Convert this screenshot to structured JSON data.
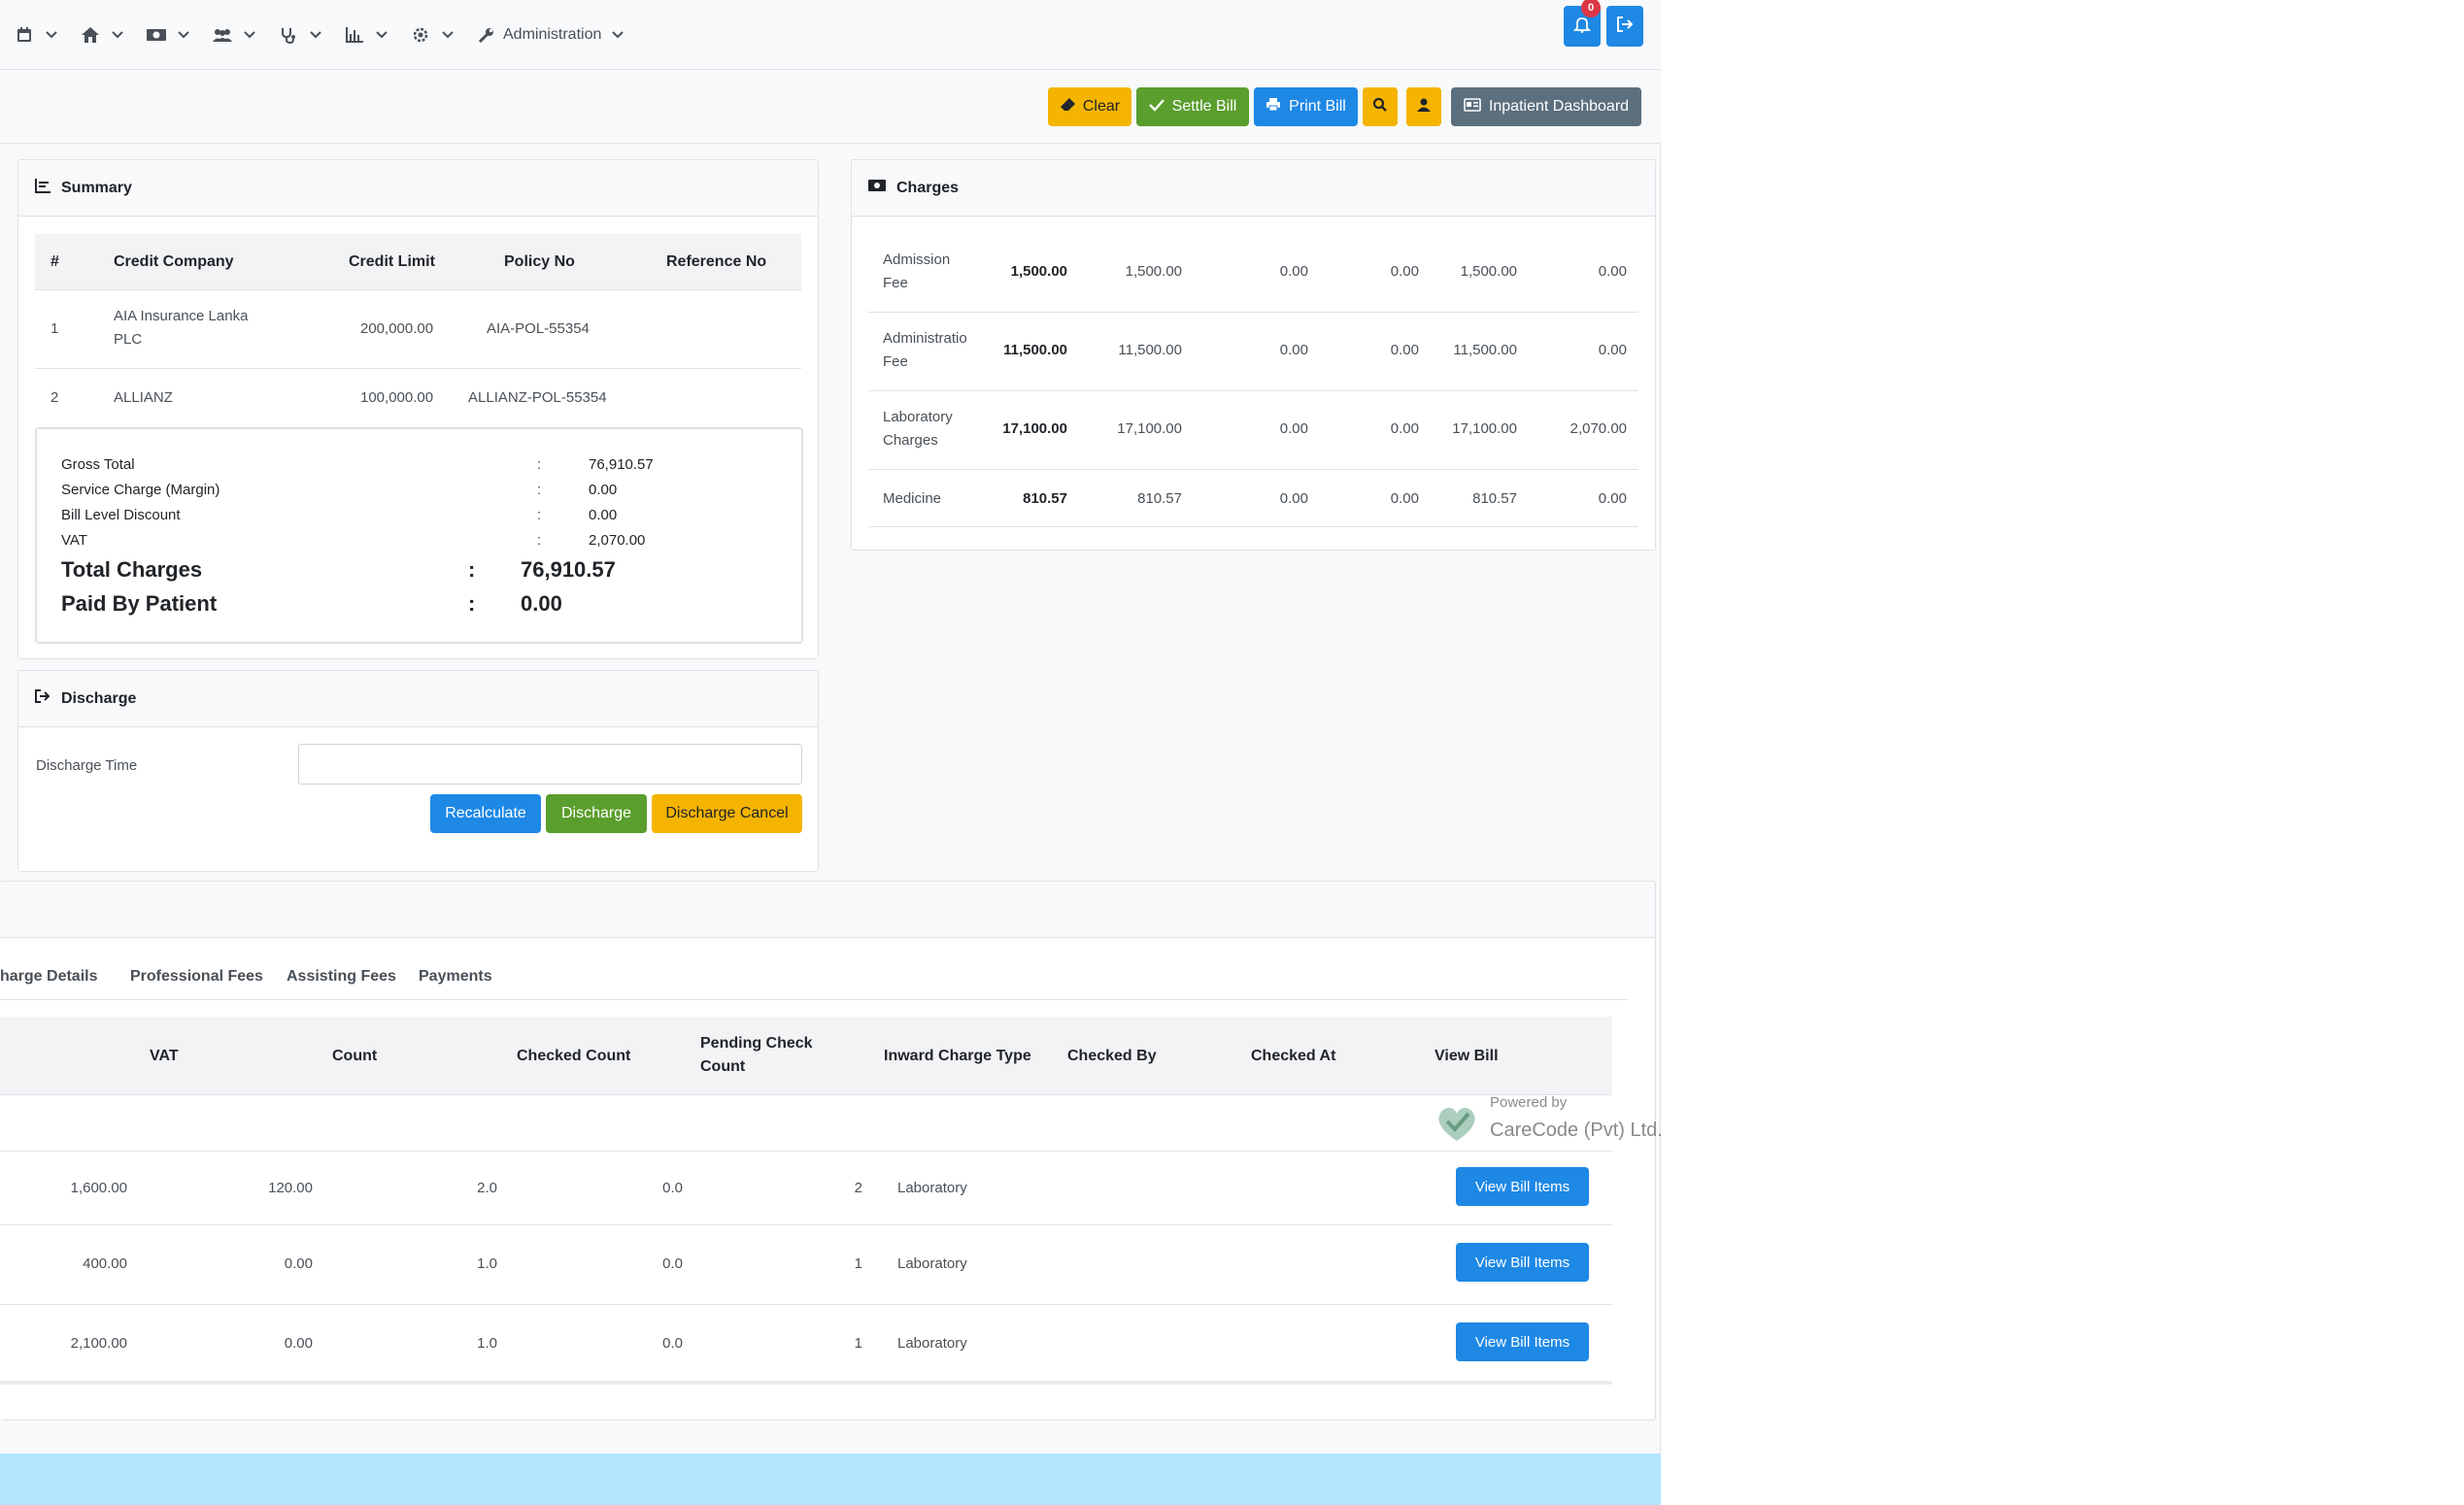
{
  "navbar": {
    "items": [
      {
        "icon": "calendar-icon"
      },
      {
        "icon": "home-icon"
      },
      {
        "icon": "money-icon"
      },
      {
        "icon": "users-icon"
      },
      {
        "icon": "stethoscope-icon"
      },
      {
        "icon": "chart-icon"
      },
      {
        "icon": "gear-icon"
      },
      {
        "icon": "wrench-icon",
        "label": "Administration"
      }
    ],
    "notification_count": "0"
  },
  "toolbar": {
    "clear": "Clear",
    "settle_bill": "Settle Bill",
    "print_bill": "Print Bill",
    "inpatient_dashboard": "Inpatient Dashboard"
  },
  "summary": {
    "title": "Summary",
    "columns": [
      "#",
      "Credit Company",
      "Credit Limit",
      "Policy No",
      "Reference No"
    ],
    "rows": [
      {
        "no": "1",
        "company_line1": "AIA Insurance Lanka",
        "company_line2": "PLC",
        "limit": "200,000.00",
        "policy": "AIA-POL-55354",
        "ref": ""
      },
      {
        "no": "2",
        "company_line1": "ALLIANZ",
        "company_line2": "",
        "limit": "100,000.00",
        "policy": "ALLIANZ-POL-55354",
        "ref": ""
      }
    ],
    "totals": [
      {
        "label": "Gross Total",
        "sep": ":",
        "value": "76,910.57"
      },
      {
        "label": "Service Charge (Margin)",
        "sep": ":",
        "value": "0.00"
      },
      {
        "label": "Bill Level Discount",
        "sep": ":",
        "value": "0.00"
      },
      {
        "label": "VAT",
        "sep": ":",
        "value": "2,070.00"
      }
    ],
    "total_charges_label": "Total Charges",
    "total_charges_value": "76,910.57",
    "paid_by_patient_label": "Paid By Patient",
    "paid_by_patient_value": "0.00",
    "colon": ":"
  },
  "charges": {
    "title": "Charges",
    "rows": [
      {
        "name_line1": "Admission",
        "name_line2": "Fee",
        "total": "1,500.00",
        "c1": "1,500.00",
        "c2": "0.00",
        "c3": "0.00",
        "c4": "1,500.00",
        "c5": "0.00"
      },
      {
        "name_line1": "Administratio",
        "name_line2": "Fee",
        "total": "11,500.00",
        "c1": "11,500.00",
        "c2": "0.00",
        "c3": "0.00",
        "c4": "11,500.00",
        "c5": "0.00"
      },
      {
        "name_line1": "Laboratory",
        "name_line2": "Charges",
        "total": "17,100.00",
        "c1": "17,100.00",
        "c2": "0.00",
        "c3": "0.00",
        "c4": "17,100.00",
        "c5": "2,070.00"
      },
      {
        "name_line1": "Medicine",
        "name_line2": "",
        "total": "810.57",
        "c1": "810.57",
        "c2": "0.00",
        "c3": "0.00",
        "c4": "810.57",
        "c5": "0.00"
      }
    ]
  },
  "discharge": {
    "title": "Discharge",
    "time_label": "Discharge Time",
    "time_value": "",
    "recalculate": "Recalculate",
    "discharge": "Discharge",
    "discharge_cancel": "Discharge Cancel"
  },
  "details": {
    "tabs": [
      "harge Details",
      "Professional Fees",
      "Assisting Fees",
      "Payments"
    ],
    "columns": [
      "VAT",
      "Count",
      "Checked Count",
      "Pending Check",
      "Count",
      "Inward Charge Type",
      "Checked By",
      "Checked At",
      "View Bill"
    ],
    "powered_by": "Powered by",
    "company": "CareCode (Pvt) Ltd.",
    "rows": [
      {
        "a": "1,600.00",
        "vat": "120.00",
        "count": "2.0",
        "checked": "0.0",
        "pending": "2",
        "type": "Laboratory",
        "btn": "View Bill Items"
      },
      {
        "a": "400.00",
        "vat": "0.00",
        "count": "1.0",
        "checked": "0.0",
        "pending": "1",
        "type": "Laboratory",
        "btn": "View Bill Items"
      },
      {
        "a": "2,100.00",
        "vat": "0.00",
        "count": "1.0",
        "checked": "0.0",
        "pending": "1",
        "type": "Laboratory",
        "btn": "View Bill Items"
      }
    ]
  }
}
